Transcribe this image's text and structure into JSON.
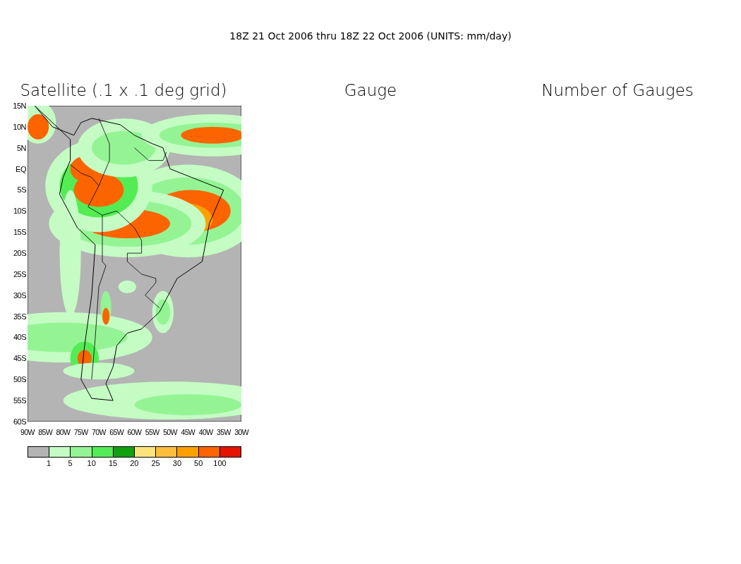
{
  "title": "18Z 21 Oct 2006 thru 18Z 22 Oct 2006 (UNITS: mm/day)",
  "panels": [
    {
      "title": "Satellite (.1 x .1 deg grid)",
      "kind": "map"
    },
    {
      "title": "Gauge",
      "kind": "empty"
    },
    {
      "title": "Number of Gauges",
      "kind": "empty"
    }
  ],
  "lat_labels": [
    "15N",
    "10N",
    "5N",
    "EQ",
    "5S",
    "10S",
    "15S",
    "20S",
    "25S",
    "30S",
    "35S",
    "40S",
    "45S",
    "50S",
    "55S",
    "60S"
  ],
  "lon_labels": [
    "90W",
    "85W",
    "80W",
    "75W",
    "70W",
    "65W",
    "60W",
    "55W",
    "50W",
    "45W",
    "40W",
    "35W",
    "30W"
  ],
  "legend": {
    "bins": [
      {
        "color": "#b4b4b4"
      },
      {
        "color": "#c4fcc4"
      },
      {
        "color": "#94f494"
      },
      {
        "color": "#54ec54"
      },
      {
        "color": "#10a010"
      },
      {
        "color": "#fce47c"
      },
      {
        "color": "#fcbc3c"
      },
      {
        "color": "#fca000"
      },
      {
        "color": "#fc6400"
      },
      {
        "color": "#e41400"
      }
    ],
    "labels": [
      "1",
      "5",
      "10",
      "15",
      "20",
      "25",
      "30",
      "50",
      "100"
    ]
  }
}
